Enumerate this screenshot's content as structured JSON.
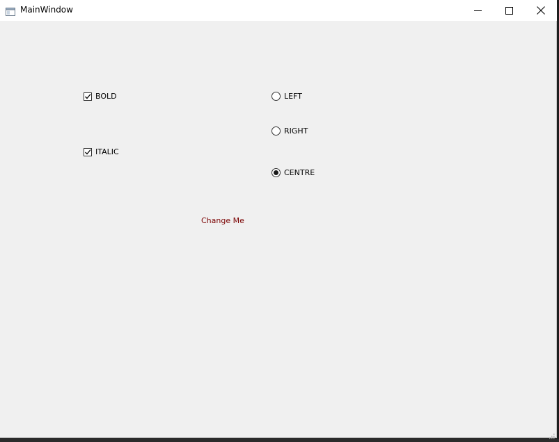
{
  "window": {
    "title": "MainWindow",
    "icon": "app-window-icon",
    "controls": {
      "minimize": "minimize-icon",
      "maximize": "maximize-icon",
      "close": "close-icon"
    }
  },
  "options": {
    "bold": {
      "label": "BOLD",
      "checked": true
    },
    "italic": {
      "label": "ITALIC",
      "checked": true
    }
  },
  "alignment": {
    "left": {
      "label": "LEFT",
      "selected": false
    },
    "right": {
      "label": "RIGHT",
      "selected": false
    },
    "centre": {
      "label": "CENTRE",
      "selected": true
    }
  },
  "preview": {
    "text": "Change Me",
    "color": "#7a0000"
  }
}
